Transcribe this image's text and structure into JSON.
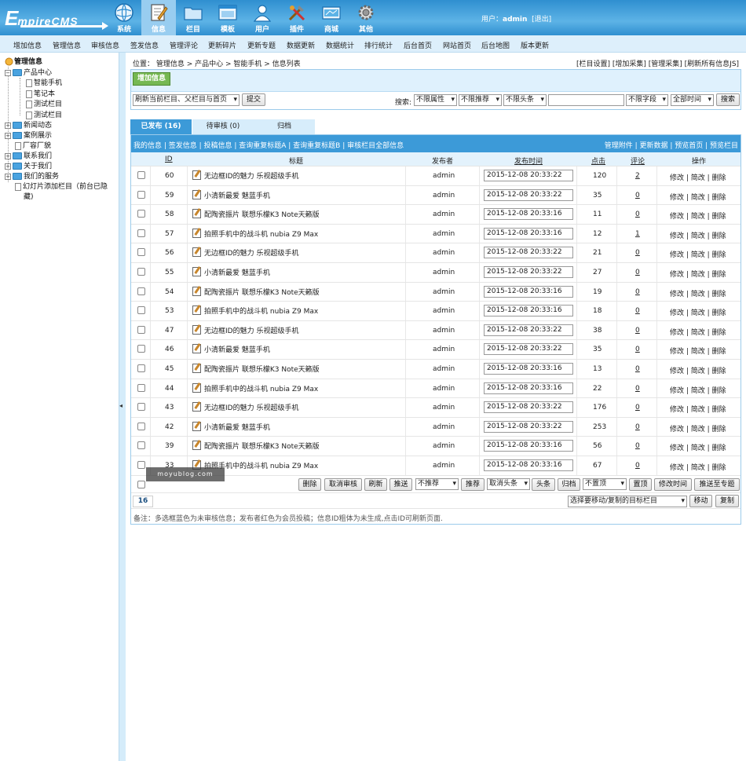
{
  "header": {
    "logo_main": "E",
    "logo_rest": "mpireCMS",
    "nav": [
      {
        "label": "系统",
        "icon": "globe-icon"
      },
      {
        "label": "信息",
        "icon": "edit-icon"
      },
      {
        "label": "栏目",
        "icon": "folder-icon"
      },
      {
        "label": "模板",
        "icon": "window-icon"
      },
      {
        "label": "用户",
        "icon": "user-icon"
      },
      {
        "label": "插件",
        "icon": "tools-icon"
      },
      {
        "label": "商城",
        "icon": "shop-icon"
      },
      {
        "label": "其他",
        "icon": "gear-icon"
      }
    ],
    "user_prefix": "用户：",
    "username": "admin",
    "logout": "[退出]"
  },
  "menubar": [
    "增加信息",
    "管理信息",
    "审核信息",
    "签发信息",
    "管理评论",
    "更新碎片",
    "更新专题",
    "数据更新",
    "数据统计",
    "排行统计",
    "后台首页",
    "网站首页",
    "后台地图",
    "版本更新"
  ],
  "sidebar": {
    "root": "管理信息",
    "items": [
      {
        "label": "产品中心",
        "type": "folder-open"
      },
      {
        "label": "智能手机",
        "type": "doc"
      },
      {
        "label": "笔记本",
        "type": "doc"
      },
      {
        "label": "测试栏目",
        "type": "doc"
      },
      {
        "label": "测试栏目",
        "type": "doc"
      },
      {
        "label": "新闻动态",
        "type": "folder"
      },
      {
        "label": "案例展示",
        "type": "folder"
      },
      {
        "label": "厂容厂貌",
        "type": "doc"
      },
      {
        "label": "联系我们",
        "type": "folder"
      },
      {
        "label": "关于我们",
        "type": "folder"
      },
      {
        "label": "我们的服务",
        "type": "folder"
      },
      {
        "label": "幻灯片添加栏目（前台已隐",
        "type": "doc"
      },
      {
        "label": "藏)",
        "type": "text"
      }
    ]
  },
  "breadcrumb": "位置： 管理信息 > 产品中心 > 智能手机 > 信息列表",
  "topright_links": "[栏目设置] [增加采集] [管理采集] [刷新所有信息JS]",
  "toolbar": {
    "add_button": "增加信息",
    "refresh_select": "刷新当前栏目、父栏目与首页",
    "submit": "提交",
    "search_label": "搜索:",
    "attr_select": "不限属性",
    "recommend_select": "不限推荐",
    "headline_select": "不限头条",
    "search_value": "",
    "field_select": "不限字段",
    "time_select": "全部时间",
    "search_button": "搜索"
  },
  "tabs": [
    "已发布 (16)",
    "待审核 (0)",
    "归档"
  ],
  "grid": {
    "actions_left": "我的信息 | 签发信息 | 投稿信息 | 查询重复标题A | 查询重复标题B | 审核栏目全部信息",
    "actions_right": "管理附件 | 更新数据 | 预览首页 | 预览栏目",
    "headers": {
      "id": "ID",
      "title": "标题",
      "publisher": "发布者",
      "time": "发布时间",
      "clicks": "点击",
      "comments": "评论",
      "ops": "操作"
    },
    "ops_text": "修改 | 简改 | 删除",
    "rows": [
      {
        "id": "60",
        "title": "无边框ID的魅力 乐视超级手机",
        "publisher": "admin",
        "time": "2015-12-08 20:33:22",
        "clicks": "120",
        "comments": "2"
      },
      {
        "id": "59",
        "title": "小清新最爱 魅蓝手机",
        "publisher": "admin",
        "time": "2015-12-08 20:33:22",
        "clicks": "35",
        "comments": "0"
      },
      {
        "id": "58",
        "title": "配陶瓷振片 联想乐檬K3 Note天籁版",
        "publisher": "admin",
        "time": "2015-12-08 20:33:16",
        "clicks": "11",
        "comments": "0"
      },
      {
        "id": "57",
        "title": "拍照手机中的战斗机 nubia Z9 Max",
        "publisher": "admin",
        "time": "2015-12-08 20:33:16",
        "clicks": "12",
        "comments": "1"
      },
      {
        "id": "56",
        "title": "无边框ID的魅力 乐视超级手机",
        "publisher": "admin",
        "time": "2015-12-08 20:33:22",
        "clicks": "21",
        "comments": "0"
      },
      {
        "id": "55",
        "title": "小清新最爱 魅蓝手机",
        "publisher": "admin",
        "time": "2015-12-08 20:33:22",
        "clicks": "27",
        "comments": "0"
      },
      {
        "id": "54",
        "title": "配陶瓷振片 联想乐檬K3 Note天籁版",
        "publisher": "admin",
        "time": "2015-12-08 20:33:16",
        "clicks": "19",
        "comments": "0"
      },
      {
        "id": "53",
        "title": "拍照手机中的战斗机 nubia Z9 Max",
        "publisher": "admin",
        "time": "2015-12-08 20:33:16",
        "clicks": "18",
        "comments": "0"
      },
      {
        "id": "47",
        "title": "无边框ID的魅力 乐视超级手机",
        "publisher": "admin",
        "time": "2015-12-08 20:33:22",
        "clicks": "38",
        "comments": "0"
      },
      {
        "id": "46",
        "title": "小清新最爱 魅蓝手机",
        "publisher": "admin",
        "time": "2015-12-08 20:33:22",
        "clicks": "35",
        "comments": "0"
      },
      {
        "id": "45",
        "title": "配陶瓷振片 联想乐檬K3 Note天籁版",
        "publisher": "admin",
        "time": "2015-12-08 20:33:16",
        "clicks": "13",
        "comments": "0"
      },
      {
        "id": "44",
        "title": "拍照手机中的战斗机 nubia Z9 Max",
        "publisher": "admin",
        "time": "2015-12-08 20:33:16",
        "clicks": "22",
        "comments": "0"
      },
      {
        "id": "43",
        "title": "无边框ID的魅力 乐视超级手机",
        "publisher": "admin",
        "time": "2015-12-08 20:33:22",
        "clicks": "176",
        "comments": "0"
      },
      {
        "id": "42",
        "title": "小清新最爱 魅蓝手机",
        "publisher": "admin",
        "time": "2015-12-08 20:33:22",
        "clicks": "253",
        "comments": "0"
      },
      {
        "id": "39",
        "title": "配陶瓷振片 联想乐檬K3 Note天籁版",
        "publisher": "admin",
        "time": "2015-12-08 20:33:16",
        "clicks": "56",
        "comments": "0"
      },
      {
        "id": "33",
        "title": "拍照手机中的战斗机 nubia Z9 Max",
        "publisher": "admin",
        "time": "2015-12-08 20:33:16",
        "clicks": "67",
        "comments": "0"
      }
    ],
    "footer_buttons": {
      "delete": "删除",
      "cancel_review": "取消审核",
      "refresh": "刷新",
      "push": "推送",
      "recommend_select": "不推荐",
      "recommend": "推荐",
      "cancel_headline_select": "取消头条",
      "headline": "头条",
      "archive": "归档",
      "top_select": "不置顶",
      "top": "置顶",
      "modify_time": "修改时间",
      "push_topic": "推送至专题"
    },
    "page_number": "16",
    "move_select": "选择要移动/复制的目标栏目",
    "move": "移动",
    "copy": "复制",
    "note": "备注：多选框蓝色为未审核信息；发布者红色为会员投稿；信息ID粗体为未生成,点击ID可刷新页面."
  },
  "watermark": "moyublog.com",
  "colors": {
    "header": "#3c9ad8",
    "menubar": "#ddeffb",
    "add_button": "#76b852",
    "grid_header": "#3c9ad8"
  }
}
